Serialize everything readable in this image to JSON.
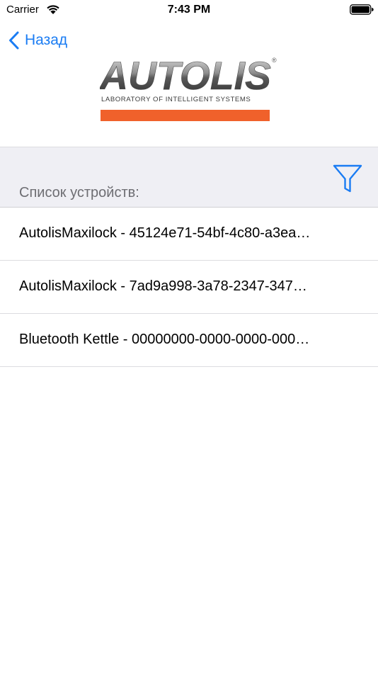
{
  "status_bar": {
    "carrier": "Carrier",
    "time": "7:43 PM",
    "wifi_icon": "wifi-icon",
    "battery_icon": "battery-icon"
  },
  "nav": {
    "back_label": "Назад",
    "back_icon": "chevron-left-icon"
  },
  "logo": {
    "wordmark": "AUTOLIS",
    "registered_mark": "®",
    "tagline": "LABORATORY OF INTELLIGENT SYSTEMS"
  },
  "section": {
    "title": "Список устройств:",
    "filter_icon": "filter-icon"
  },
  "devices": [
    {
      "label": "AutolisMaxilock - 45124e71-54bf-4c80-a3ea…"
    },
    {
      "label": "AutolisMaxilock - 7ad9a998-3a78-2347-347…"
    },
    {
      "label": "Bluetooth Kettle - 00000000-0000-0000-000…"
    }
  ],
  "colors": {
    "accent": "#1a7cf3",
    "brand_orange": "#f0612b",
    "section_bg": "#efeff4",
    "section_text": "#6d6d72",
    "separator": "#dcdce0"
  }
}
